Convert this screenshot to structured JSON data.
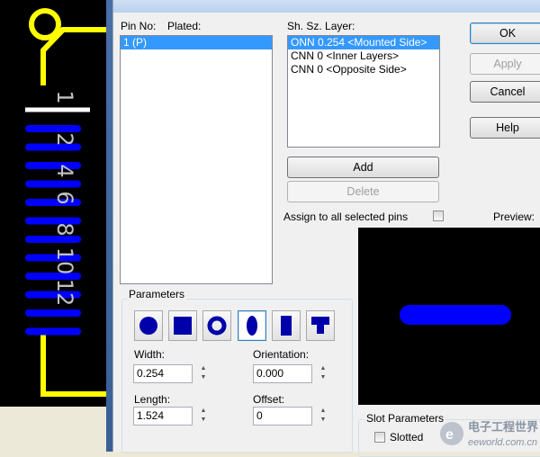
{
  "colors": {
    "pcb_background": "#000000",
    "silkscreen": "#ffff00",
    "pad": "#0000ff",
    "pin_text": "#c0c0c0",
    "selection": "#3399ff"
  },
  "pcb": {
    "pin_labels": [
      "1",
      "2",
      "4",
      "6",
      "8",
      "10",
      "12"
    ]
  },
  "pin_list": {
    "header_pin_no": "Pin No:",
    "header_plated": "Plated:",
    "items": [
      "1 (P)"
    ]
  },
  "layer_list": {
    "header": "Sh. Sz. Layer:",
    "items": [
      "ONN 0.254 <Mounted Side>",
      "CNN 0 <Inner Layers>",
      "CNN 0 <Opposite Side>"
    ]
  },
  "buttons": {
    "ok": "OK",
    "apply": "Apply",
    "cancel": "Cancel",
    "help": "Help",
    "add": "Add",
    "delete": "Delete"
  },
  "assign_all": {
    "label": "Assign to all selected pins",
    "checked": false
  },
  "preview": {
    "label": "Preview:"
  },
  "parameters": {
    "title": "Parameters",
    "shapes": [
      "circle-shape",
      "square-shape",
      "ring-shape",
      "oval-shape",
      "rectangle-shape",
      "custom-shape"
    ],
    "selected_shape": "oval-shape",
    "width_label": "Width:",
    "width": "0.254",
    "orientation_label": "Orientation:",
    "orientation": "0.000",
    "length_label": "Length:",
    "length": "1.524",
    "offset_label": "Offset:",
    "offset": "0"
  },
  "slot": {
    "title": "Slot Parameters",
    "slotted_label": "Slotted",
    "slotted": false
  },
  "watermark": {
    "cn_text": "电子工程世界",
    "url": "eeworld.com.cn"
  }
}
